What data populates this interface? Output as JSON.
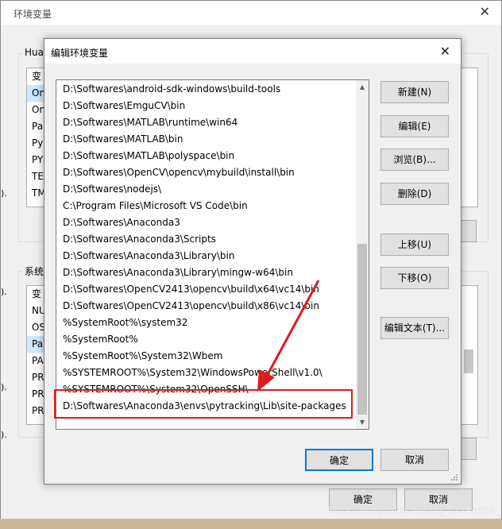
{
  "back_dialog": {
    "title": "环境变量",
    "close_glyph": "✕",
    "user_group_label": "Hua",
    "user_vars_cut": [
      "变",
      "On",
      "On",
      "Pa",
      "Py",
      "PY",
      "TE",
      "TM"
    ],
    "sys_group_label": "系统",
    "sys_vars_cut": [
      "变",
      "NU",
      "OS",
      "Pa",
      "PA",
      "PR",
      "PR",
      "PR"
    ],
    "ok_label": "确定",
    "cancel_label": "取消",
    "edge_marks": [
      ").",
      ").",
      ").",
      ")."
    ]
  },
  "edit_dialog": {
    "title": "编辑环境变量",
    "close_glyph": "✕",
    "paths": [
      "D:\\Softwares\\android-sdk-windows\\build-tools",
      "D:\\Softwares\\EmguCV\\bin",
      "D:\\Softwares\\MATLAB\\runtime\\win64",
      "D:\\Softwares\\MATLAB\\bin",
      "D:\\Softwares\\MATLAB\\polyspace\\bin",
      "D:\\Softwares\\OpenCV\\opencv\\mybuild\\install\\bin",
      "D:\\Softwares\\nodejs\\",
      "C:\\Program Files\\Microsoft VS Code\\bin",
      "D:\\Softwares\\Anaconda3",
      "D:\\Softwares\\Anaconda3\\Scripts",
      "D:\\Softwares\\Anaconda3\\Library\\bin",
      "D:\\Softwares\\Anaconda3\\Library\\mingw-w64\\bin",
      "D:\\Softwares\\OpenCV2413\\opencv\\build\\x64\\vc14\\bin",
      "D:\\Softwares\\OpenCV2413\\opencv\\build\\x86\\vc14\\bin",
      "%SystemRoot%\\system32",
      "%SystemRoot%",
      "%SystemRoot%\\System32\\Wbem",
      "%SYSTEMROOT%\\System32\\WindowsPowerShell\\v1.0\\",
      "%SYSTEMROOT%\\System32\\OpenSSH\\",
      "D:\\Softwares\\Anaconda3\\envs\\pytracking\\Lib\\site-packages"
    ],
    "buttons": {
      "new": "新建(N)",
      "edit": "编辑(E)",
      "browse": "浏览(B)...",
      "delete": "删除(D)",
      "move_up": "上移(U)",
      "move_down": "下移(O)",
      "edit_text": "编辑文本(T)..."
    },
    "ok_label": "确定",
    "cancel_label": "取消",
    "scroll_up_glyph": "▲",
    "scroll_down_glyph": "▼",
    "highlight_color": "#e11b1b"
  },
  "watermark": "https://blog.csdn.net/qq_17783559"
}
